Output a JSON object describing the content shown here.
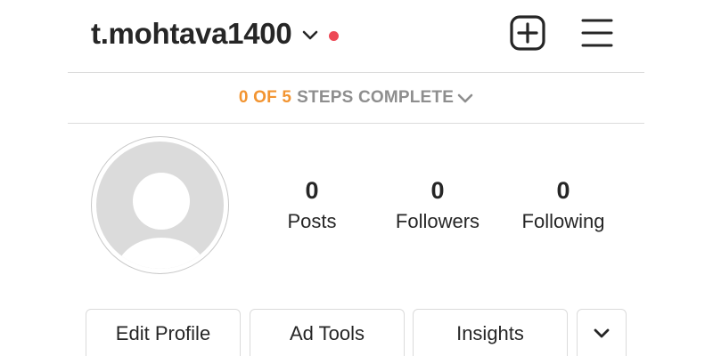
{
  "header": {
    "username": "t.mohtava1400",
    "notification_dot_color": "#ed4956",
    "icons": {
      "account_switch": "chevron-down-icon",
      "new_post": "plus-square-icon",
      "menu": "hamburger-menu-icon"
    }
  },
  "steps": {
    "count": "0 OF 5",
    "rest": "STEPS COMPLETE",
    "accent_color": "#f29431",
    "icon": "chevron-down-icon"
  },
  "profile": {
    "avatar_icon": "default-avatar-icon",
    "stats": [
      {
        "value": "0",
        "label": "Posts"
      },
      {
        "value": "0",
        "label": "Followers"
      },
      {
        "value": "0",
        "label": "Following"
      }
    ]
  },
  "actions": {
    "edit_profile": "Edit Profile",
    "ad_tools": "Ad Tools",
    "insights": "Insights",
    "more_icon": "chevron-down-icon"
  }
}
